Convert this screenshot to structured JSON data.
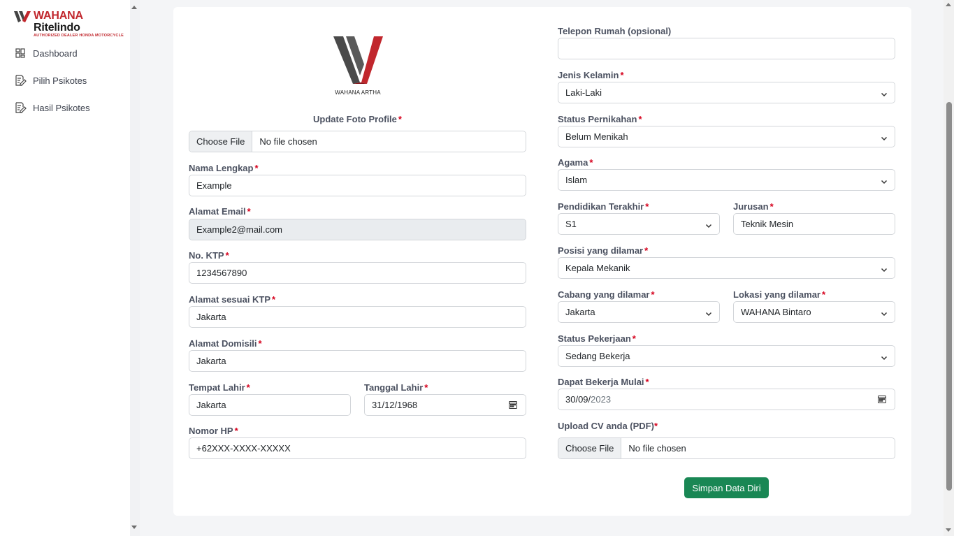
{
  "brand": {
    "name_part1": "WAHANA",
    "name_part2": "Ritelindo",
    "tagline": "AUTHORIZED DEALER HONDA MOTORCYCLE"
  },
  "sidebar": {
    "items": [
      {
        "label": "Dashboard",
        "icon": "grid-icon"
      },
      {
        "label": "Pilih Psikotes",
        "icon": "edit-document-icon"
      },
      {
        "label": "Hasil Psikotes",
        "icon": "edit-document-icon"
      }
    ]
  },
  "logo": {
    "caption": "WAHANA ARTHA"
  },
  "form": {
    "required_mark": "*",
    "photo": {
      "label": "Update Foto Profile",
      "button": "Choose File",
      "status": "No file chosen"
    },
    "nama": {
      "label": "Nama Lengkap",
      "value": "Example"
    },
    "email": {
      "label": "Alamat Email",
      "value": "Example2@mail.com"
    },
    "ktp": {
      "label": "No. KTP",
      "value": "1234567890"
    },
    "alamat_ktp": {
      "label": "Alamat sesuai KTP",
      "value": "Jakarta"
    },
    "domisili": {
      "label": "Alamat Domisili",
      "value": "Jakarta"
    },
    "tempat_lahir": {
      "label": "Tempat Lahir",
      "value": "Jakarta"
    },
    "tanggal_lahir": {
      "label": "Tanggal Lahir",
      "value": "31/12/1968"
    },
    "hp": {
      "label": "Nomor HP",
      "value": "+62XXX-XXXX-XXXXX"
    },
    "telepon_rumah": {
      "label": "Telepon Rumah (opsional)",
      "value": ""
    },
    "jenis_kelamin": {
      "label": "Jenis Kelamin",
      "value": "Laki-Laki"
    },
    "status_pernikahan": {
      "label": "Status Pernikahan",
      "value": "Belum Menikah"
    },
    "agama": {
      "label": "Agama",
      "value": "Islam"
    },
    "pendidikan": {
      "label": "Pendidikan Terakhir",
      "value": "S1"
    },
    "jurusan": {
      "label": "Jurusan",
      "value": "Teknik Mesin"
    },
    "posisi": {
      "label": "Posisi yang dilamar",
      "value": "Kepala Mekanik"
    },
    "cabang": {
      "label": "Cabang yang dilamar",
      "value": "Jakarta"
    },
    "lokasi": {
      "label": "Lokasi yang dilamar",
      "value": "WAHANA Bintaro"
    },
    "status_pekerjaan": {
      "label": "Status Pekerjaan",
      "value": "Sedang Bekerja"
    },
    "mulai_kerja": {
      "label": "Dapat Bekerja Mulai",
      "value_dm": "30/09/",
      "value_y": "2023"
    },
    "cv": {
      "label": "Upload CV anda (PDF)",
      "button": "Choose File",
      "status": "No file chosen"
    },
    "submit_label": "Simpan Data Diri"
  },
  "colors": {
    "primary_green": "#198754",
    "brand_red": "#c1272d",
    "required_red": "#d6001c"
  }
}
